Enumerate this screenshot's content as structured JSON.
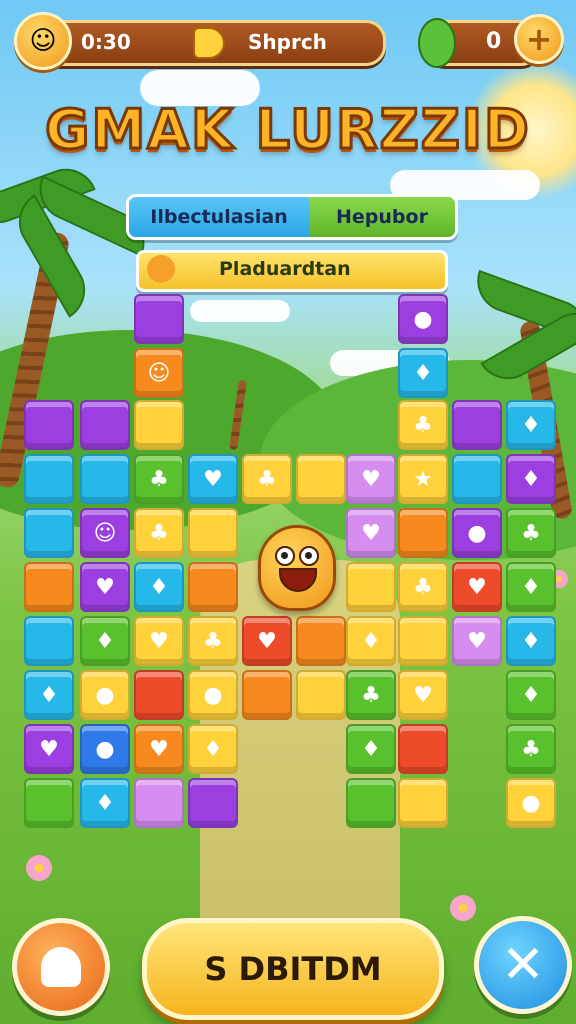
{
  "hud": {
    "timer": "0:30",
    "mode_label": "Shprch",
    "coin_count": "0",
    "add_symbol": "+"
  },
  "title": "GMAK LURZZID",
  "banners": {
    "left": "Ilbectulasian",
    "right": "Hepubor",
    "sub": "Pladuardtan"
  },
  "actions": {
    "start_label": "S DBITDM",
    "close_symbol": "✕"
  },
  "colors": {
    "purple": "#9b3fe0",
    "cyan": "#27b8ea",
    "green": "#59c12d",
    "yellow": "#ffd13a",
    "orange": "#f78a1e",
    "red": "#ee4b2b",
    "pink": "#d68df0",
    "blue": "#2f79e8"
  },
  "board": [
    {
      "c": "purple",
      "g": ""
    },
    {
      "c": "orange",
      "g": "☺"
    },
    {
      "c": "yellow",
      "g": ""
    },
    {
      "c": "purple",
      "g": "●"
    },
    {
      "c": "cyan",
      "g": "♦"
    },
    {
      "c": "yellow",
      "g": "♣"
    },
    {
      "c": "purple",
      "g": ""
    },
    {
      "c": "cyan",
      "g": "♦"
    },
    {
      "c": "purple",
      "g": ""
    },
    {
      "c": "purple",
      "g": ""
    },
    {
      "c": "cyan",
      "g": ""
    },
    {
      "c": "cyan",
      "g": ""
    },
    {
      "c": "green",
      "g": "♣"
    },
    {
      "c": "cyan",
      "g": "♥"
    },
    {
      "c": "yellow",
      "g": "♣"
    },
    {
      "c": "yellow",
      "g": ""
    },
    {
      "c": "purple",
      "g": "♥"
    },
    {
      "c": "yellow",
      "g": "★"
    },
    {
      "c": "cyan",
      "g": ""
    },
    {
      "c": "purple",
      "g": "♦"
    }
  ]
}
